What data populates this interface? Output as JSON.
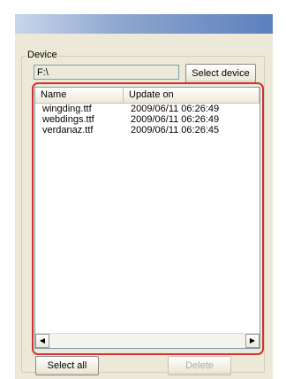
{
  "group": {
    "label": "Device"
  },
  "device": {
    "path": "F:\\",
    "select_device_label": "Select device"
  },
  "list": {
    "columns": [
      "Name",
      "Update on"
    ],
    "rows": [
      {
        "name": "wingding.ttf",
        "updated": "2009/06/11 06:26:49"
      },
      {
        "name": "webdings.ttf",
        "updated": "2009/06/11 06:26:49"
      },
      {
        "name": "verdanaz.ttf",
        "updated": "2009/06/11 06:26:45"
      }
    ]
  },
  "actions": {
    "select_all_label": "Select all",
    "delete_label": "Delete"
  },
  "scroll": {
    "left_icon": "◀",
    "right_icon": "▶"
  },
  "colors": {
    "highlight_outline": "#d62f2f",
    "title_bar": "#5c7fbd"
  }
}
